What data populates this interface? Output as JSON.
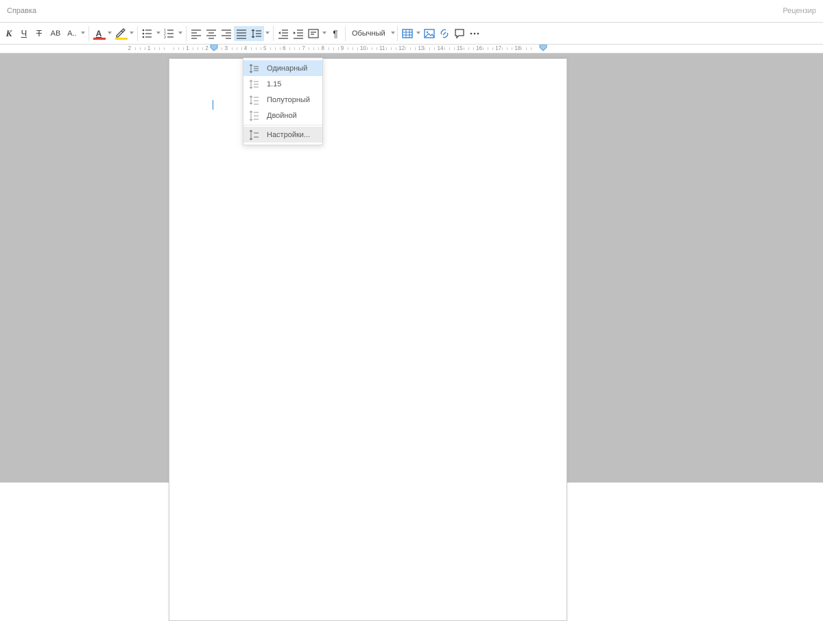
{
  "menubar": {
    "help": "Справка",
    "review": "Рецензир"
  },
  "toolbar": {
    "style_label": "Обычный",
    "font_color": "#d9403a",
    "highlight_color": "#ffd600",
    "table_color": "#2d7dd2"
  },
  "ruler": {
    "neg": [
      "1",
      "2"
    ],
    "pos": [
      "",
      "1",
      "2",
      "3",
      "4",
      "5",
      "6",
      "7",
      "8",
      "9",
      "10",
      "11",
      "12",
      "13",
      "14",
      "15",
      "16",
      "17",
      "18"
    ]
  },
  "line_spacing_menu": {
    "single": "Одинарный",
    "one15": "1.15",
    "one5": "Полуторный",
    "double": "Двойной",
    "settings": "Настройки..."
  }
}
